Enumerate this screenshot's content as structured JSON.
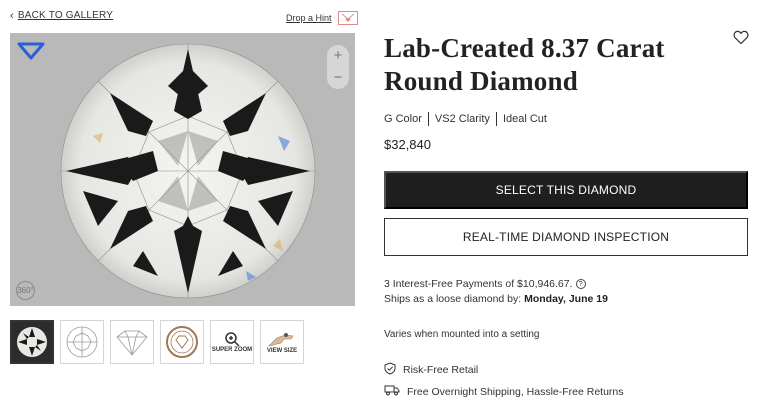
{
  "nav": {
    "back_label": "BACK TO GALLERY"
  },
  "hint": {
    "label": "Drop a Hint"
  },
  "viewer": {
    "zoom_in": "+",
    "zoom_out": "−",
    "rotate_label": "360°"
  },
  "thumbnails": [
    {
      "kind": "diamond-photo",
      "label": ""
    },
    {
      "kind": "top-diagram",
      "label": ""
    },
    {
      "kind": "side-diagram",
      "label": ""
    },
    {
      "kind": "certificate",
      "label": ""
    },
    {
      "kind": "super-zoom",
      "label": "SUPER ZOOM"
    },
    {
      "kind": "view-size",
      "label": "VIEW SIZE"
    }
  ],
  "product": {
    "title": "Lab-Created 8.37 Carat Round Diamond",
    "specs": [
      "G Color",
      "VS2 Clarity",
      "Ideal Cut"
    ],
    "price": "$32,840"
  },
  "actions": {
    "select_label": "SELECT THIS DIAMOND",
    "inspect_label": "REAL-TIME DIAMOND INSPECTION"
  },
  "financing": {
    "payments_text": "3 Interest-Free Payments of $10,946.67.",
    "ships_prefix": "Ships as a loose diamond by:",
    "ships_date": "Monday, June 19"
  },
  "note": "Varies when mounted into a setting",
  "features": [
    {
      "icon": "shield-check-icon",
      "label": "Risk-Free Retail"
    },
    {
      "icon": "truck-icon",
      "label": "Free Overnight Shipping, Hassle-Free Returns"
    }
  ],
  "colors": {
    "brand_blue": "#2b5fd9",
    "primary_button": "#1f1f1f",
    "hint_pink": "#e28a8a"
  }
}
